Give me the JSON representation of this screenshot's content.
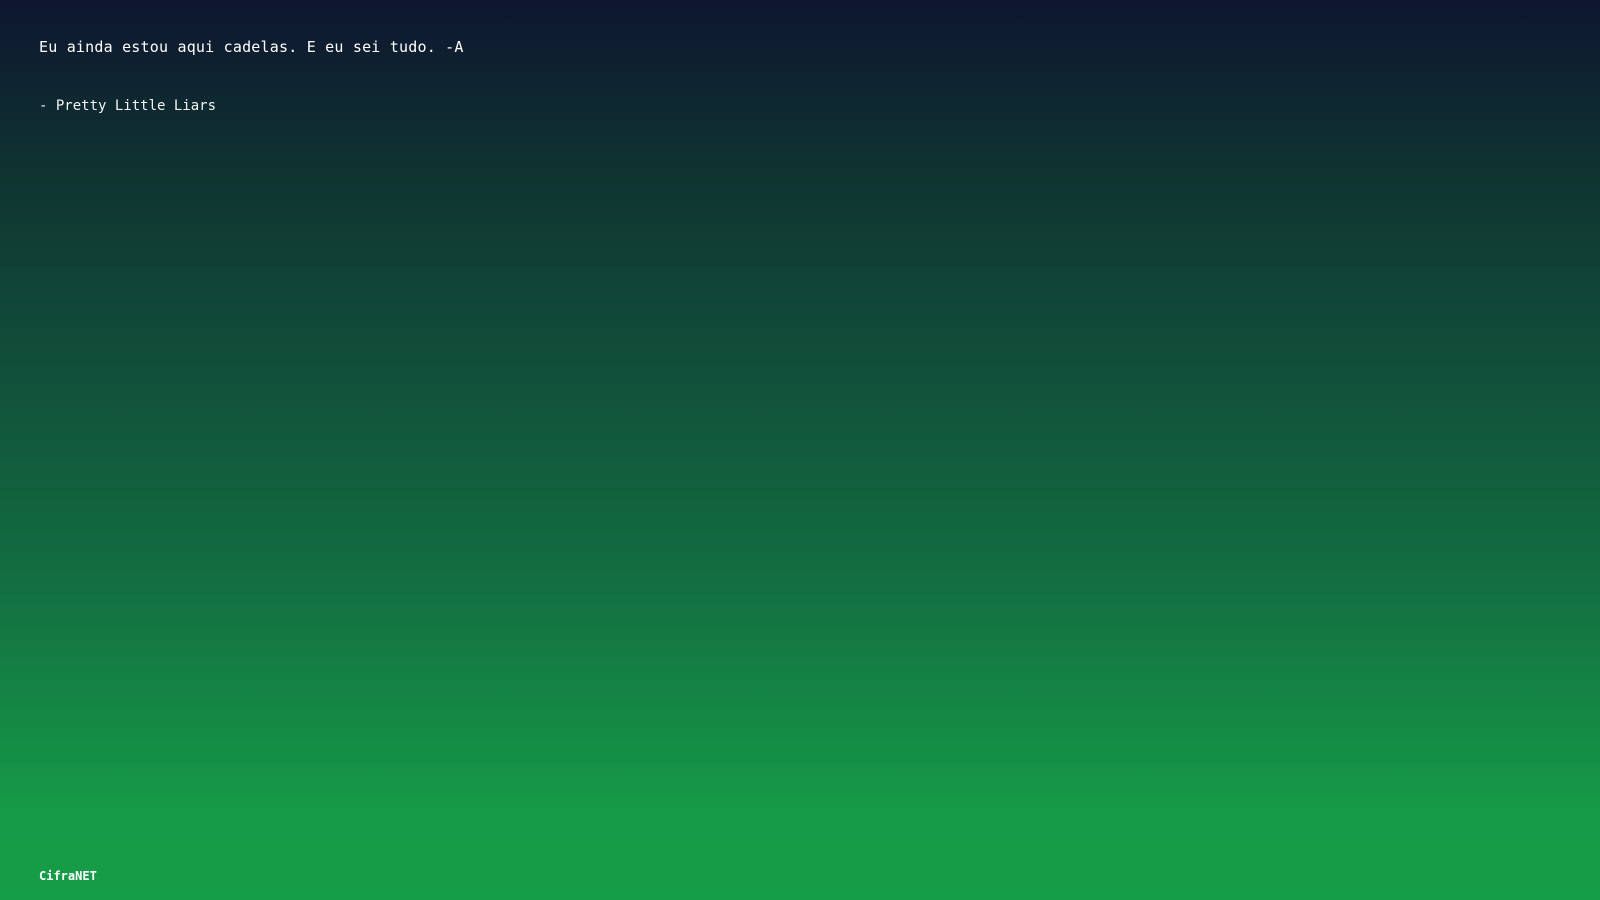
{
  "quote": {
    "text": "Eu ainda estou aqui cadelas. E eu sei tudo. -A",
    "attribution": "- Pretty Little Liars"
  },
  "footer": {
    "brand": "CifraNET"
  },
  "colors": {
    "gradient_top": "#0e1630",
    "gradient_bottom": "#169d47",
    "text": "#ffffff"
  }
}
